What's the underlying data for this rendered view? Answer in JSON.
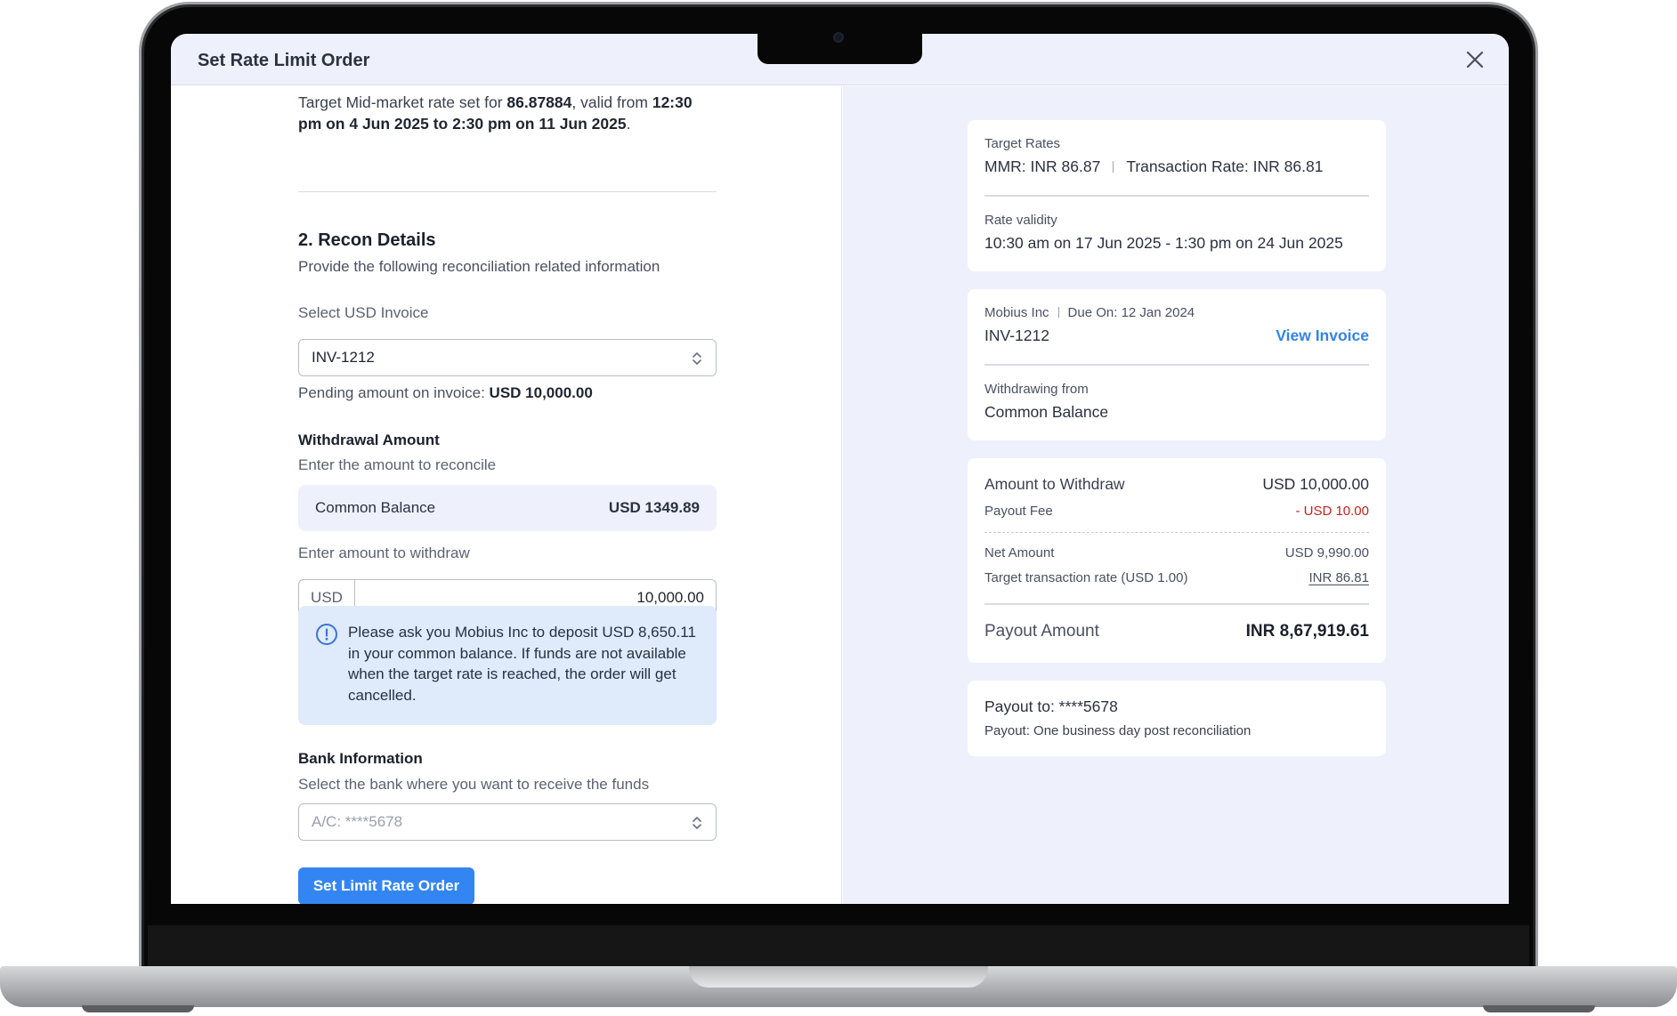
{
  "modal": {
    "title": "Set Rate Limit Order"
  },
  "left": {
    "target_prefix": "Target Mid-market rate set for ",
    "target_rate": "86.87884",
    "target_mid": ", valid from ",
    "target_validity": "12:30 pm on 4 Jun 2025 to 2:30 pm on 11 Jun 2025",
    "target_suffix": ".",
    "section_title": "2. Recon Details",
    "section_subtitle": "Provide the following reconciliation related information",
    "invoice_label": "Select USD Invoice",
    "invoice_value": "INV-1212",
    "pending_label": "Pending amount on invoice: ",
    "pending_value": "USD 10,000.00",
    "withdrawal_title": "Withdrawal Amount",
    "withdrawal_subtitle": "Enter the amount to reconcile",
    "balance_name": "Common Balance",
    "balance_amount": "USD 1349.89",
    "amount_label": "Enter amount to withdraw",
    "amount_currency": "USD",
    "amount_value": "10,000.00",
    "alert_text": "Please ask you Mobius Inc to deposit USD 8,650.11 in your common balance. If funds are not available when the target rate is reached, the order will get cancelled.",
    "bank_title": "Bank Information",
    "bank_subtitle": "Select the bank where you want to receive the funds",
    "bank_placeholder": "A/C: ****5678",
    "submit_label": "Set Limit Rate Order"
  },
  "right": {
    "rates_card": {
      "label": "Target Rates",
      "mmr": "MMR: INR 86.87",
      "transaction_rate": "Transaction Rate: INR 86.81",
      "validity_label": "Rate validity",
      "validity_value": "10:30 am on 17 Jun 2025 - 1:30 pm on 24 Jun 2025"
    },
    "invoice_card": {
      "company": "Mobius Inc",
      "due": "Due On: 12 Jan 2024",
      "invoice": "INV-1212",
      "view_link": "View Invoice",
      "withdraw_label": "Withdrawing from",
      "withdraw_value": "Common Balance"
    },
    "summary_card": {
      "amount_label": "Amount to Withdraw",
      "amount_value": "USD 10,000.00",
      "fee_label": "Payout Fee",
      "fee_value": "- USD 10.00",
      "net_label": "Net Amount",
      "net_value": "USD 9,990.00",
      "rate_label": "Target transaction rate (USD  1.00)",
      "rate_value": "INR 86.81",
      "payout_label": "Payout Amount",
      "payout_value": "INR 8,67,919.61"
    },
    "payout_card": {
      "payout_to": "Payout to: ****5678",
      "payout_timing": "Payout: One business day post reconciliation"
    }
  },
  "colors": {
    "primary": "#3386f1",
    "link": "#3583e6",
    "fee_red": "#c2221d",
    "panel_bg": "#eef1fb",
    "alert_bg": "#dfeafa"
  }
}
